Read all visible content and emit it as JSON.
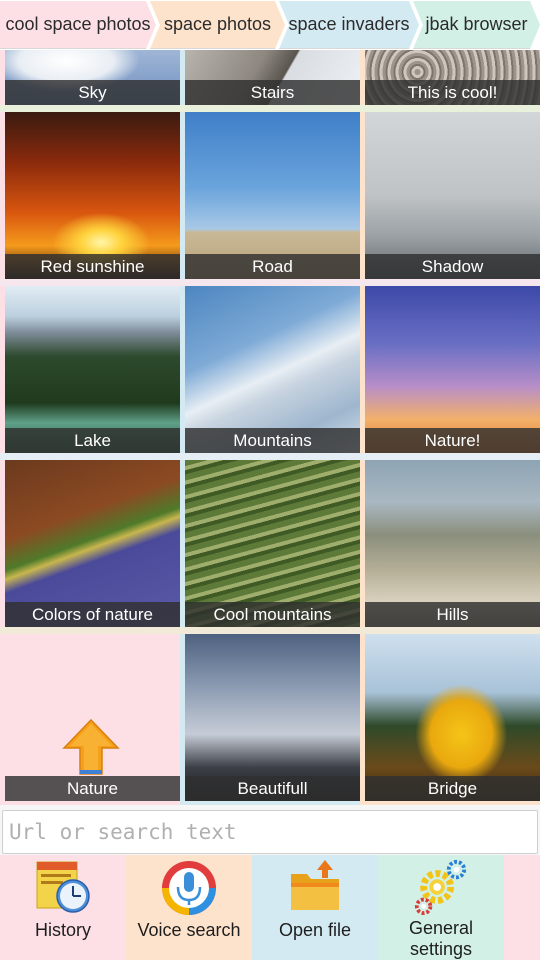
{
  "tabs": [
    {
      "label": "cool space photos",
      "color": "#fde0e6"
    },
    {
      "label": "space photos",
      "color": "#fde3cc"
    },
    {
      "label": "space invaders",
      "color": "#d4eaf2"
    },
    {
      "label": "jbak browser",
      "color": "#d2f0e6"
    }
  ],
  "tiles": [
    {
      "label": "Sky"
    },
    {
      "label": "Stairs"
    },
    {
      "label": "This is cool!"
    },
    {
      "label": "Red sunshine"
    },
    {
      "label": "Road"
    },
    {
      "label": "Shadow"
    },
    {
      "label": "Lake"
    },
    {
      "label": "Mountains"
    },
    {
      "label": "Nature!"
    },
    {
      "label": "Colors of nature"
    },
    {
      "label": "Cool mountains"
    },
    {
      "label": "Hills"
    },
    {
      "label": "Nature",
      "icon": "up-arrow-icon"
    },
    {
      "label": "Beautifull"
    },
    {
      "label": "Bridge"
    }
  ],
  "search": {
    "placeholder": "Url or search text",
    "value": ""
  },
  "toolbar": {
    "items": [
      {
        "label": "History",
        "icon": "history-clock-icon",
        "color": "#fde0e6"
      },
      {
        "label": "Voice search",
        "icon": "microphone-icon",
        "color": "#fde3cc"
      },
      {
        "label": "Open file",
        "icon": "folder-icon",
        "color": "#d4eaf2"
      },
      {
        "label": "General settings",
        "icon": "gears-icon",
        "color": "#d2f0e6"
      }
    ]
  }
}
